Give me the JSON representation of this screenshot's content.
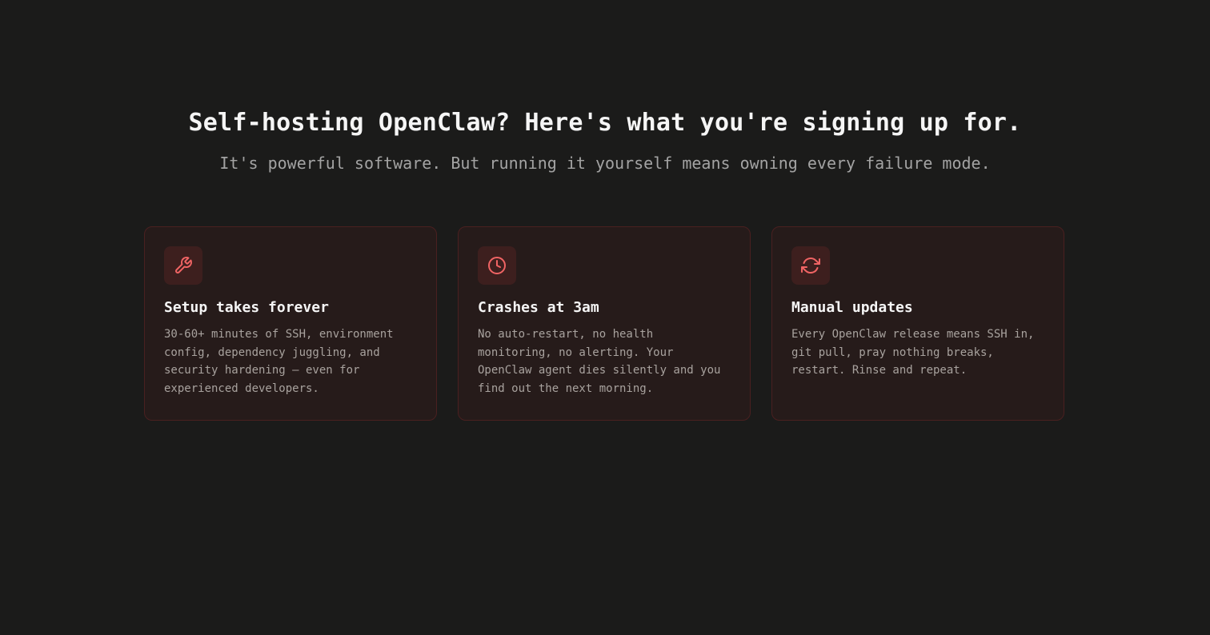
{
  "header": {
    "title": "Self-hosting OpenClaw? Here's what you're signing up for.",
    "subtitle": "It's powerful software. But running it yourself means owning every failure mode."
  },
  "colors": {
    "accent": "#f06464",
    "background": "#1b1b1a",
    "card": "#261b1a"
  },
  "cards": [
    {
      "icon": "wrench-icon",
      "title": "Setup takes forever",
      "body": "30-60+ minutes of SSH, environment config, dependency juggling, and security hardening — even for experienced developers."
    },
    {
      "icon": "clock-icon",
      "title": "Crashes at 3am",
      "body": "No auto-restart, no health monitoring, no alerting. Your OpenClaw agent dies silently and you find out the next morning."
    },
    {
      "icon": "refresh-icon",
      "title": "Manual updates",
      "body": "Every OpenClaw release means SSH in, git pull, pray nothing breaks, restart. Rinse and repeat."
    }
  ]
}
